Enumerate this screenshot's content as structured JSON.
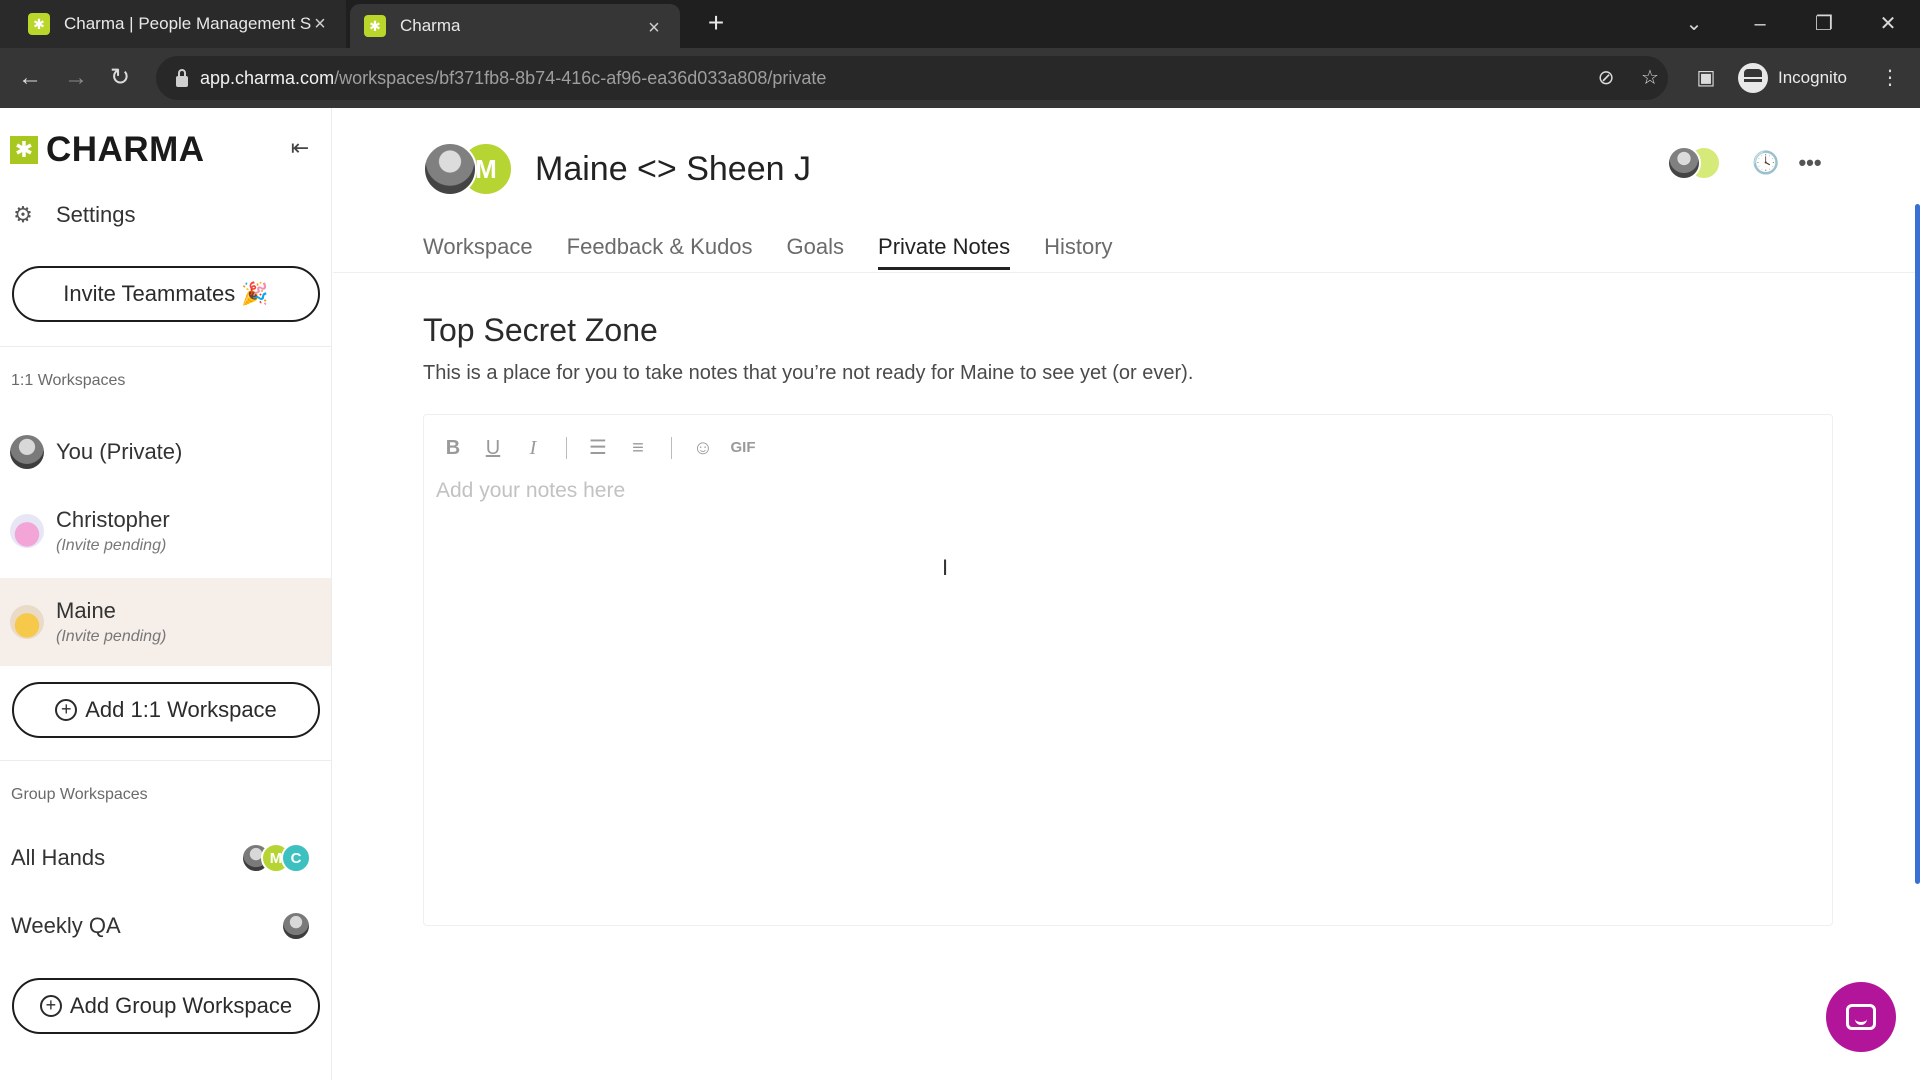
{
  "browser": {
    "tabs": [
      {
        "title": "Charma | People Management S",
        "active": false
      },
      {
        "title": "Charma",
        "active": true
      }
    ],
    "url_host": "app.charma.com",
    "url_path": "/workspaces/bf371fb8-8b74-416c-af96-ea36d033a808/private",
    "profile_label": "Incognito"
  },
  "sidebar": {
    "logo_text": "CHARMA",
    "settings_label": "Settings",
    "invite_label": "Invite Teammates 🎉",
    "one_on_one_heading": "1:1 Workspaces",
    "workspaces": [
      {
        "name": "You (Private)",
        "status": "",
        "active": false
      },
      {
        "name": "Christopher",
        "status": "(Invite pending)",
        "active": false
      },
      {
        "name": "Maine",
        "status": "(Invite pending)",
        "active": true
      }
    ],
    "add_workspace_label": "Add 1:1 Workspace",
    "group_heading": "Group Workspaces",
    "groups": [
      {
        "name": "All Hands",
        "members": [
          "photo",
          "M",
          "C"
        ]
      },
      {
        "name": "Weekly QA",
        "members": [
          "photo"
        ]
      }
    ],
    "add_group_label": "Add Group Workspace"
  },
  "header": {
    "title": "Maine <> Sheen J",
    "avatar_letter": "M"
  },
  "tabs": [
    {
      "label": "Workspace",
      "active": false
    },
    {
      "label": "Feedback & Kudos",
      "active": false
    },
    {
      "label": "Goals",
      "active": false
    },
    {
      "label": "Private Notes",
      "active": true
    },
    {
      "label": "History",
      "active": false
    }
  ],
  "content": {
    "zone_title": "Top Secret Zone",
    "zone_description": "This is a place for you to take notes that you’re not ready for Maine to see yet (or ever).",
    "editor_placeholder": "Add your notes here",
    "toolbar": {
      "bold": "B",
      "underline": "U",
      "italic": "I",
      "gif": "GIF"
    }
  },
  "colors": {
    "brand": "#a8c81f",
    "chat_button": "#b3159a",
    "active_workspace_bg": "#f6eee9"
  }
}
